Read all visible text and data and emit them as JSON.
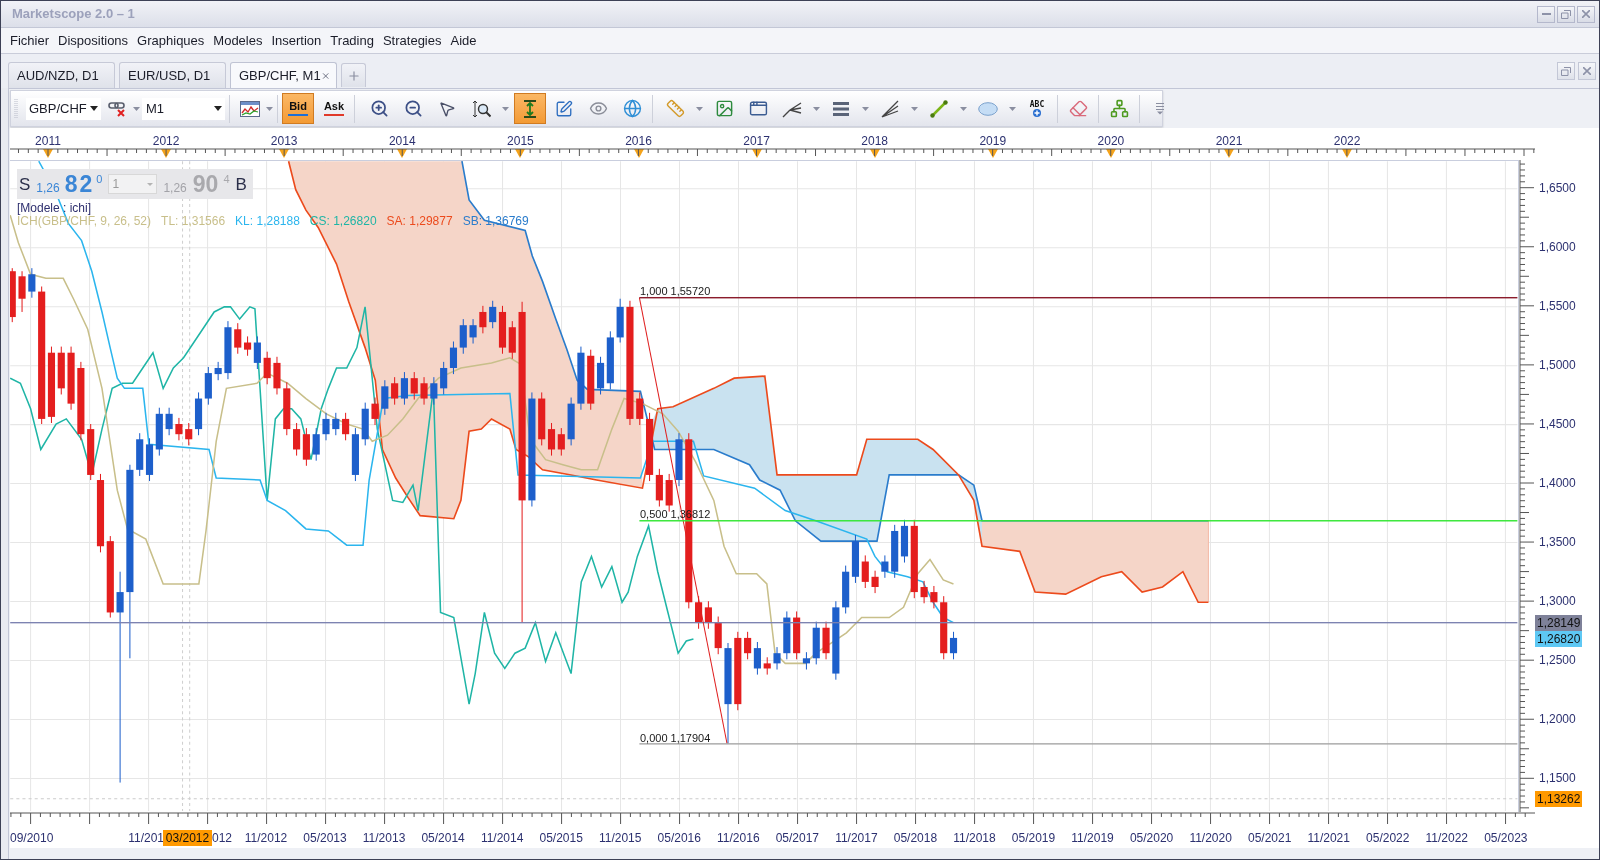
{
  "window": {
    "title": "Marketscope 2.0 – 1"
  },
  "menu": [
    "Fichier",
    "Dispositions",
    "Graphiques",
    "Modeles",
    "Insertion",
    "Trading",
    "Strategies",
    "Aide"
  ],
  "tabs": [
    {
      "label": "AUD/NZD, D1",
      "selected": false
    },
    {
      "label": "EUR/USD, D1",
      "selected": false
    },
    {
      "label": "GBP/CHF, M1",
      "selected": true
    }
  ],
  "toolbar": {
    "symbol": "GBP/CHF",
    "timeframe": "M1",
    "price_sides": [
      {
        "label": "Bid",
        "selected": true,
        "color": "#1f6fd6"
      },
      {
        "label": "Ask",
        "selected": false,
        "color": "#e03a2a"
      }
    ],
    "tools": [
      {
        "selected": false
      },
      {
        "selected": false
      },
      {
        "selected": false
      },
      {
        "selected": false
      },
      {
        "selected": false
      },
      {
        "selected": false
      },
      {
        "selected": true
      },
      {
        "selected": false
      },
      {
        "selected": false
      },
      {
        "selected": false
      },
      {
        "selected": false
      },
      {
        "selected": false
      },
      {
        "selected": false
      },
      {
        "selected": false
      },
      {
        "selected": false
      },
      {
        "selected": false
      },
      {
        "selected": false
      },
      {
        "selected": false
      },
      {
        "selected": false,
        "label": "ABC"
      },
      {
        "selected": false
      },
      {
        "selected": false
      },
      {
        "selected": false
      }
    ]
  },
  "chart": {
    "year_labels": [
      "2011",
      "2012",
      "2013",
      "2014",
      "2015",
      "2016",
      "2017",
      "2018",
      "2019",
      "2020",
      "2021",
      "2022"
    ],
    "quote": {
      "sell_label": "S",
      "sell_prefix": "1,26",
      "sell_pips": "82",
      "sell_fraction": "0",
      "lot": {
        "value": "1",
        "disabled": true
      },
      "buy_prefix": "1,26",
      "buy_pips": "90",
      "buy_fraction": "4",
      "buy_label": "B"
    },
    "model_label": "[Modele : ichi]",
    "legend": [
      {
        "text": "ICH(GBP/CHF, 9, 26, 52)",
        "color": "#c8bf8a"
      },
      {
        "text": "TL: 1,31566",
        "color": "#c8bf8a"
      },
      {
        "text": "KL: 1,28188",
        "color": "#2bb5ee"
      },
      {
        "text": "CS: 1,26820",
        "color": "#1fb5a6"
      },
      {
        "text": "SA: 1,29877",
        "color": "#ec4a1c"
      },
      {
        "text": "SB: 1,36769",
        "color": "#2a7ccc"
      }
    ],
    "fib_levels": [
      {
        "text": "1,000 1,55720",
        "color": "#8b1c2c"
      },
      {
        "text": "0,500 1,36812",
        "color": "#33e633"
      },
      {
        "text": "0,000 1,17904",
        "color": "#a8a8a8"
      }
    ],
    "price_labels": [
      "1,6500",
      "1,6000",
      "1,5500",
      "1,5000",
      "1,4500",
      "1,4000",
      "1,3500",
      "1,3000",
      "1,2500",
      "1,2000",
      "1,1500"
    ],
    "price_tags": [
      {
        "text": "1,28149",
        "color": "#7e8199"
      },
      {
        "text": "1,26820",
        "color": "#5ec8f4"
      },
      {
        "text": "1,13262",
        "color": "#ff9900"
      }
    ],
    "date_labels": [
      "09/2010",
      "11/201",
      "012",
      "11/2012",
      "05/2013",
      "11/2013",
      "05/2014",
      "11/2014",
      "05/2015",
      "11/2015",
      "05/2016",
      "11/2016",
      "05/2017",
      "11/2017",
      "05/2018",
      "11/2018",
      "05/2019",
      "11/2019",
      "05/2020",
      "11/2020",
      "05/2021",
      "11/2021",
      "05/2022",
      "11/2022",
      "05/2023"
    ],
    "crosshair_date": "03/2012"
  }
}
